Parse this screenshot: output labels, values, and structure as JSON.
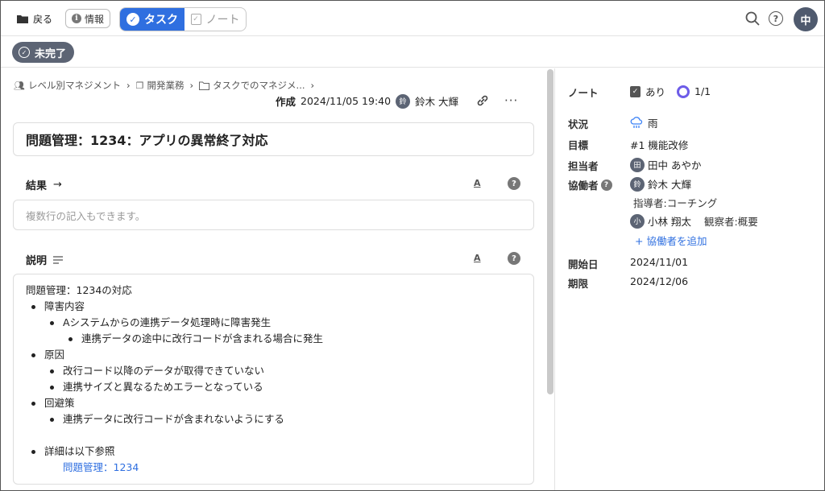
{
  "topbar": {
    "back_label": "戻る",
    "info_label": "情報",
    "tab_task": "タスク",
    "tab_note": "ノート",
    "user_avatar": "中"
  },
  "status": {
    "label": "未完了"
  },
  "breadcrumb": [
    "レベル別マネジメント",
    "開発業務",
    "タスクでのマネジメ..."
  ],
  "meta": {
    "created_label": "作成",
    "created_at": "2024/11/05 19:40",
    "author_avatar": "鈴",
    "author": "鈴木 大輝"
  },
  "task_title": "問題管理：1234：アプリの異常終了対応",
  "result": {
    "heading": "結果",
    "placeholder": "複数行の記入もできます。",
    "format_label": "A"
  },
  "description": {
    "heading": "説明",
    "format_label": "A",
    "lines": [
      "問題管理：1234の対応",
      "障害内容",
      "Aシステムからの連携データ処理時に障害発生",
      "連携データの途中に改行コードが含まれる場合に発生",
      "原因",
      "改行コード以降のデータが取得できていない",
      "連携サイズと異なるためエラーとなっている",
      "回避策",
      "連携データに改行コードが含まれないようにする",
      "詳細は以下参照",
      "問題管理：1234"
    ]
  },
  "properties": {
    "note_label": "ノート",
    "note_value": "あり",
    "note_count": "1/1",
    "status_label": "状況",
    "status_value": "雨",
    "goal_label": "目標",
    "goal_value": "#1 機能改修",
    "assignee_label": "担当者",
    "assignee_avatar": "田",
    "assignee_value": "田中 あやか",
    "collab_label": "協働者",
    "collab1_avatar": "鈴",
    "collab1_name": "鈴木 大輝",
    "collab1_role": "指導者:コーチング",
    "collab2_avatar": "小",
    "collab2_name": "小林 翔太",
    "collab2_role": "観察者:概要",
    "add_collab": "+ 協働者を追加",
    "start_label": "開始日",
    "start_value": "2024/11/01",
    "due_label": "期限",
    "due_value": "2024/12/06"
  },
  "colors": {
    "accent": "#2f6fe0",
    "status_pill": "#5c6474",
    "progress_ring": "#6d5ce8"
  }
}
